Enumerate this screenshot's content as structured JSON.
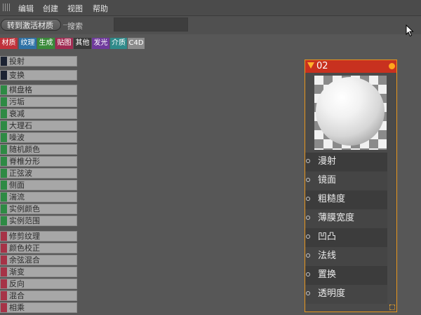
{
  "menu": {
    "items": [
      "编辑",
      "创建",
      "视图",
      "帮助"
    ]
  },
  "toolbar": {
    "convert_label": "转到激活材质",
    "search_label": "搜索",
    "search_value": ""
  },
  "tabs": [
    {
      "label": "材质",
      "color": "#c0313a"
    },
    {
      "label": "纹理",
      "color": "#2f72a6"
    },
    {
      "label": "生成",
      "color": "#3a8a3a"
    },
    {
      "label": "贴图",
      "color": "#a02b52"
    },
    {
      "label": "其他",
      "color": "#3a3a3a"
    },
    {
      "label": "发光",
      "color": "#6f3a9c"
    },
    {
      "label": "介质",
      "color": "#2f8a8a"
    },
    {
      "label": "C4D",
      "color": "#8c8c8c"
    }
  ],
  "list": {
    "groups": [
      {
        "color": "#1c2333",
        "items": [
          "投射",
          "变换"
        ]
      },
      {
        "color": "#2e8a44",
        "items": [
          "棋盘格",
          "污垢",
          "衰减",
          "大理石",
          "噪波",
          "随机颜色",
          "脊椎分形",
          "正弦波",
          "侧面",
          "湍流",
          "实例颜色",
          "实例范围"
        ]
      },
      {
        "color": "#a63347",
        "items": [
          "修剪纹理",
          "颜色校正",
          "余弦混合",
          "渐变",
          "反向",
          "混合",
          "相乘"
        ]
      }
    ]
  },
  "node": {
    "title": "02",
    "ports": [
      "漫射",
      "镜面",
      "粗糙度",
      "薄膜宽度",
      "凹凸",
      "法线",
      "置换",
      "透明度"
    ]
  }
}
